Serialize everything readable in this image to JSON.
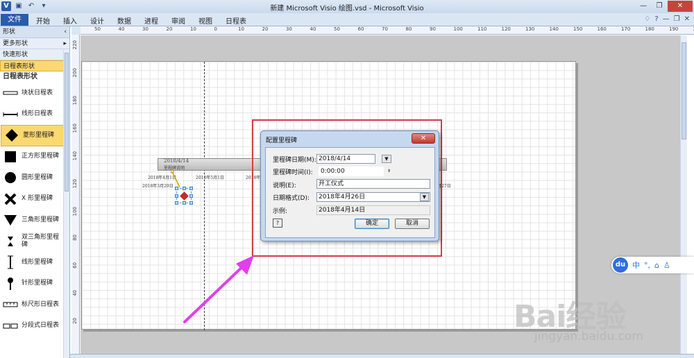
{
  "window": {
    "title": "新建 Microsoft Visio 绘图.vsd - Microsoft Visio",
    "app_icon": "V",
    "controls": [
      "—",
      "❐",
      "✕"
    ]
  },
  "ribbon": {
    "file_label": "文件",
    "tabs": [
      "开始",
      "插入",
      "设计",
      "数据",
      "进程",
      "审阅",
      "视图",
      "日程表"
    ],
    "right_icons": [
      "♢",
      "?",
      "—",
      "❐",
      "✕"
    ]
  },
  "shapes_pane": {
    "header": "形状",
    "rows": [
      {
        "label": "更多形状",
        "arrow": "▸"
      },
      {
        "label": "快速形状",
        "arrow": ""
      },
      {
        "label": "日程表形状",
        "arrow": ""
      }
    ],
    "stencil_title": "日程表形状",
    "items": [
      {
        "label": "块状日程表",
        "icon": "block-timeline-icon"
      },
      {
        "label": "线形日程表",
        "icon": "line-timeline-icon"
      },
      {
        "label": "菱形里程碑",
        "icon": "diamond-milestone-icon"
      },
      {
        "label": "正方形里程碑",
        "icon": "square-milestone-icon"
      },
      {
        "label": "圆形里程碑",
        "icon": "circle-milestone-icon"
      },
      {
        "label": "X 形里程碑",
        "icon": "x-milestone-icon"
      },
      {
        "label": "三角形里程碑",
        "icon": "triangle-milestone-icon"
      },
      {
        "label": "双三角形里程碑",
        "icon": "double-triangle-milestone-icon"
      },
      {
        "label": "线形里程碑",
        "icon": "line-milestone-icon"
      },
      {
        "label": "针形里程碑",
        "icon": "pin-milestone-icon"
      },
      {
        "label": "标尺形日程表",
        "icon": "ruler-timeline-icon"
      },
      {
        "label": "分段式日程表",
        "icon": "segmented-timeline-icon"
      }
    ]
  },
  "ruler": {
    "top": [
      "50",
      "40",
      "30",
      "20",
      "10",
      "0",
      "10",
      "20",
      "30",
      "40",
      "50",
      "60",
      "70",
      "80",
      "90",
      "100",
      "110",
      "120",
      "130",
      "140",
      "150",
      "160",
      "170",
      "180",
      "190",
      "200"
    ],
    "left": [
      "220",
      "200",
      "180",
      "160",
      "140",
      "120",
      "100",
      "80",
      "60",
      "40",
      "20"
    ]
  },
  "timeline": {
    "milestone_date": "2018/4/14",
    "milestone_desc": "里程碑说明",
    "dates": [
      "2018年4月1日",
      "2018年3月29日",
      "2018年5月1日",
      "2018年6",
      "2018年9月27日"
    ]
  },
  "dialog": {
    "title": "配置里程碑",
    "close": "✕",
    "fields": [
      {
        "label": "里程碑日期(M):",
        "value": "2018/4/14"
      },
      {
        "label": "里程碑时间(I):",
        "value": "0:00:00"
      },
      {
        "label": "说明(E):",
        "value": "开工仪式"
      },
      {
        "label": "日期格式(D):",
        "value": "2018年4月26日"
      },
      {
        "label": "示例:",
        "value": "2018年4月14日"
      }
    ],
    "help": "?",
    "ok": "确定",
    "cancel": "取消"
  },
  "baidu_widget": {
    "logo": "du",
    "items": [
      "中",
      "°,",
      "⌂",
      "♙"
    ]
  },
  "watermark": {
    "logo": "Bai经验",
    "url": "jingyan.baidu.com"
  },
  "colors": {
    "highlight_box": "#d63a48",
    "arrow": "#e040e8",
    "file_tab": "#2a5caa"
  }
}
